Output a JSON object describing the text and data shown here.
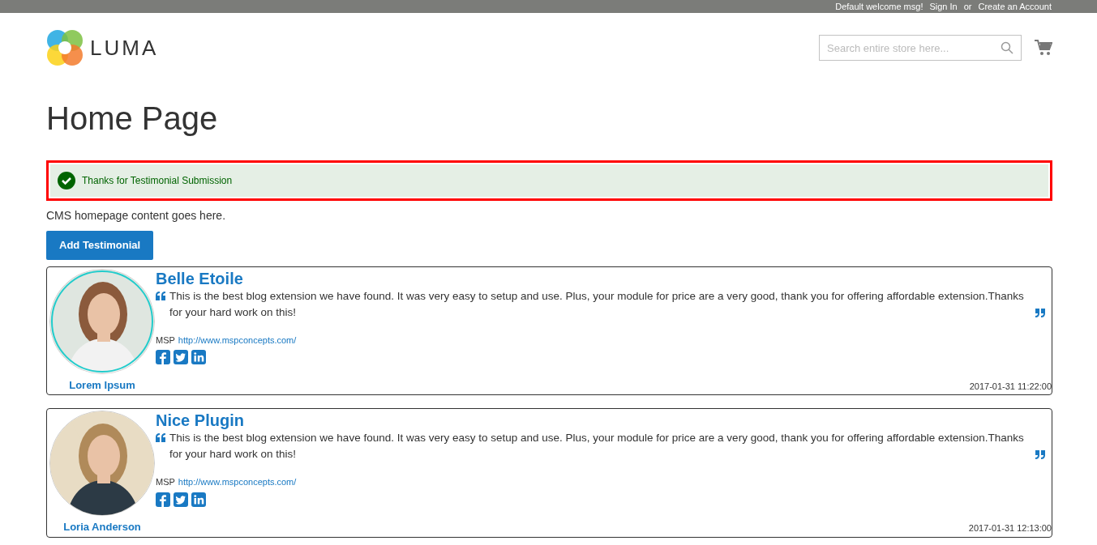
{
  "top_bar": {
    "welcome": "Default welcome msg!",
    "sign_in": "Sign In",
    "or": "or",
    "create_account": "Create an Account"
  },
  "header": {
    "logo_text": "LUMA",
    "search": {
      "placeholder": "Search entire store here..."
    }
  },
  "page_title": "Home Page",
  "message": {
    "text": "Thanks for Testimonial Submission",
    "outlined": true
  },
  "cms_text": "CMS homepage content goes here.",
  "add_button": "Add Testimonial",
  "testimonials": [
    {
      "title": "Belle Etoile",
      "text": "This is the best blog extension we have found. It was very easy to setup and use. Plus, your module for price are a very good, thank you for offering affordable extension.Thanks for your hard work on this!",
      "company": "MSP",
      "website": "http://www.mspconcepts.com/",
      "author": "Lorem Ipsum",
      "date": "2017-01-31 11:22:00",
      "highlighted": true
    },
    {
      "title": "Nice Plugin",
      "text": "This is the best blog extension we have found. It was very easy to setup and use. Plus, your module for price are a very good, thank you for offering affordable extension.Thanks for your hard work on this!",
      "company": "MSP",
      "website": "http://www.mspconcepts.com/",
      "author": "Loria Anderson",
      "date": "2017-01-31 12:13:00",
      "highlighted": false
    }
  ]
}
